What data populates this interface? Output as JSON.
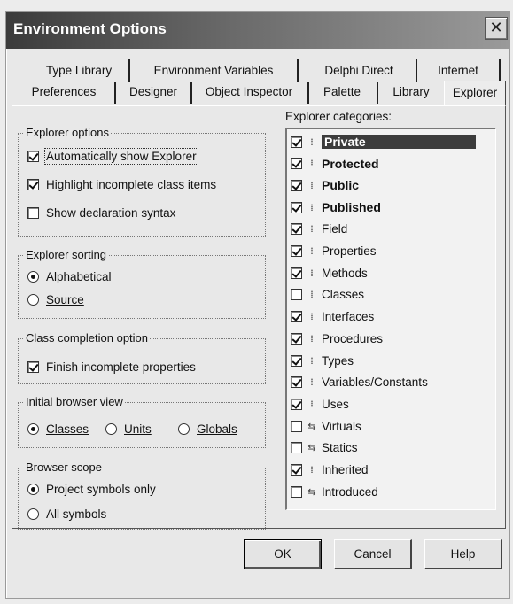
{
  "window": {
    "title": "Environment Options"
  },
  "tabs_back": [
    {
      "label": "Type Library"
    },
    {
      "label": "Environment Variables"
    },
    {
      "label": "Delphi Direct"
    },
    {
      "label": "Internet"
    }
  ],
  "tabs_front": [
    {
      "label": "Preferences"
    },
    {
      "label": "Designer"
    },
    {
      "label": "Object Inspector"
    },
    {
      "label": "Palette"
    },
    {
      "label": "Library"
    },
    {
      "label": "Explorer"
    }
  ],
  "explorer_options": {
    "label": "Explorer options",
    "items": [
      {
        "label": "Automatically show Explorer",
        "checked": true
      },
      {
        "label": "Highlight incomplete class items",
        "checked": true
      },
      {
        "label": "Show declaration syntax",
        "checked": false
      }
    ]
  },
  "explorer_sorting": {
    "label": "Explorer sorting",
    "items": [
      {
        "label": "Alphabetical",
        "selected": true
      },
      {
        "label": "Source",
        "selected": false
      }
    ]
  },
  "class_completion": {
    "label": "Class completion option",
    "items": [
      {
        "label": "Finish incomplete properties",
        "checked": true
      }
    ]
  },
  "initial_browser_view": {
    "label": "Initial browser view",
    "items": [
      {
        "label": "Classes",
        "selected": true
      },
      {
        "label": "Units",
        "selected": false
      },
      {
        "label": "Globals",
        "selected": false
      }
    ]
  },
  "browser_scope": {
    "label": "Browser scope",
    "items": [
      {
        "label": "Project symbols only",
        "selected": true
      },
      {
        "label": "All symbols",
        "selected": false
      }
    ]
  },
  "explorer_categories": {
    "label": "Explorer categories:",
    "items": [
      {
        "label": "Private",
        "checked": true,
        "bold": true,
        "selected": true,
        "icon": "member-icon"
      },
      {
        "label": "Protected",
        "checked": true,
        "bold": true,
        "icon": "member-icon"
      },
      {
        "label": "Public",
        "checked": true,
        "bold": true,
        "icon": "member-icon"
      },
      {
        "label": "Published",
        "checked": true,
        "bold": true,
        "icon": "member-icon"
      },
      {
        "label": "Field",
        "checked": true,
        "icon": "member-icon"
      },
      {
        "label": "Properties",
        "checked": true,
        "icon": "member-icon"
      },
      {
        "label": "Methods",
        "checked": true,
        "icon": "member-icon"
      },
      {
        "label": "Classes",
        "checked": false,
        "icon": "member-icon"
      },
      {
        "label": "Interfaces",
        "checked": true,
        "icon": "member-icon"
      },
      {
        "label": "Procedures",
        "checked": true,
        "icon": "member-icon"
      },
      {
        "label": "Types",
        "checked": true,
        "icon": "member-icon"
      },
      {
        "label": "Variables/Constants",
        "checked": true,
        "icon": "member-icon"
      },
      {
        "label": "Uses",
        "checked": true,
        "icon": "member-icon"
      },
      {
        "label": "Virtuals",
        "checked": false,
        "icon": "virtual-icon"
      },
      {
        "label": "Statics",
        "checked": false,
        "icon": "virtual-icon"
      },
      {
        "label": "Inherited",
        "checked": true,
        "icon": "member-icon"
      },
      {
        "label": "Introduced",
        "checked": false,
        "icon": "virtual-icon"
      }
    ]
  },
  "buttons": {
    "ok": "OK",
    "cancel": "Cancel",
    "help": "Help"
  },
  "close_glyph": "✕"
}
